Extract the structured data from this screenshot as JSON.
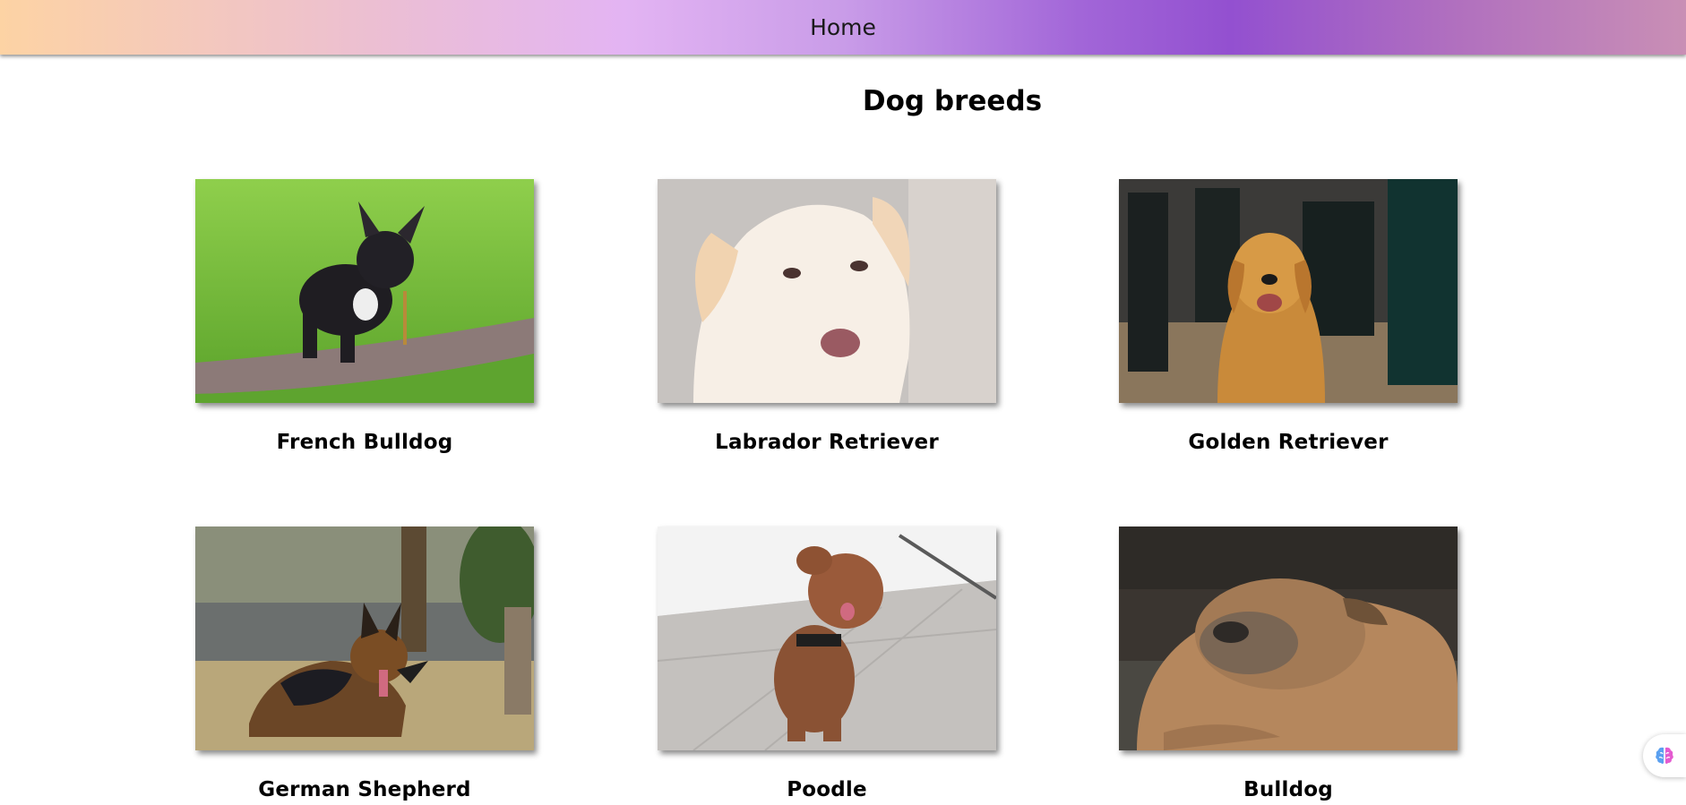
{
  "nav": {
    "home_label": "Home"
  },
  "page": {
    "title": "Dog breeds"
  },
  "breeds": [
    {
      "name": "French Bulldog",
      "image": "french-bulldog-photo"
    },
    {
      "name": "Labrador Retriever",
      "image": "labrador-retriever-photo"
    },
    {
      "name": "Golden Retriever",
      "image": "golden-retriever-photo"
    },
    {
      "name": "German Shepherd",
      "image": "german-shepherd-photo"
    },
    {
      "name": "Poodle",
      "image": "poodle-photo"
    },
    {
      "name": "Bulldog",
      "image": "bulldog-photo"
    }
  ],
  "assistant": {
    "icon": "brain-icon"
  },
  "colors": {
    "header_gradient_start": "#fdd3a4",
    "header_gradient_mid": "#e3b4f3",
    "header_gradient_accent": "#9350d0",
    "text": "#000000"
  }
}
